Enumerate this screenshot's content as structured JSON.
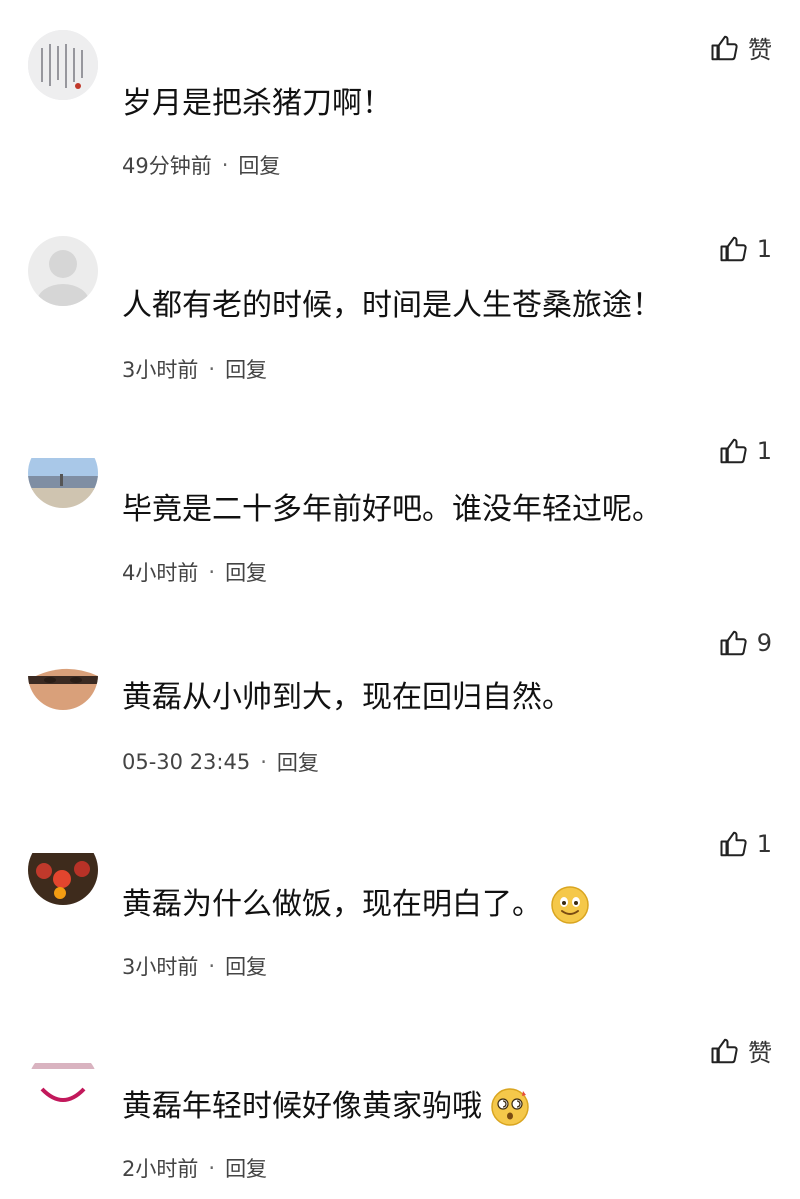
{
  "comments": [
    {
      "like_label": "赞",
      "text": "岁月是把杀猪刀啊！",
      "time": "49分钟前",
      "reply": "回复",
      "emoji": ""
    },
    {
      "like_label": "1",
      "text": "人都有老的时候，时间是人生苍桑旅途！",
      "time": "3小时前",
      "reply": "回复",
      "emoji": ""
    },
    {
      "like_label": "1",
      "text": "毕竟是二十多年前好吧。谁没年轻过呢。",
      "time": "4小时前",
      "reply": "回复",
      "emoji": ""
    },
    {
      "like_label": "9",
      "text": "黄磊从小帅到大，现在回归自然。",
      "time": "05-30 23:45",
      "reply": "回复",
      "emoji": ""
    },
    {
      "like_label": "1",
      "text": "黄磊为什么做饭，现在明白了。",
      "time": "3小时前",
      "reply": "回复",
      "emoji": "smiling-face-icon"
    },
    {
      "like_label": "赞",
      "text": "黄磊年轻时候好像黄家驹哦",
      "time": "2小时前",
      "reply": "回复",
      "emoji": "dizzy-face-icon"
    }
  ],
  "meta_separator": "·",
  "colors": {
    "text": "#111111",
    "meta": "#444444",
    "background": "#ffffff",
    "emoji": "#f5c84a"
  }
}
